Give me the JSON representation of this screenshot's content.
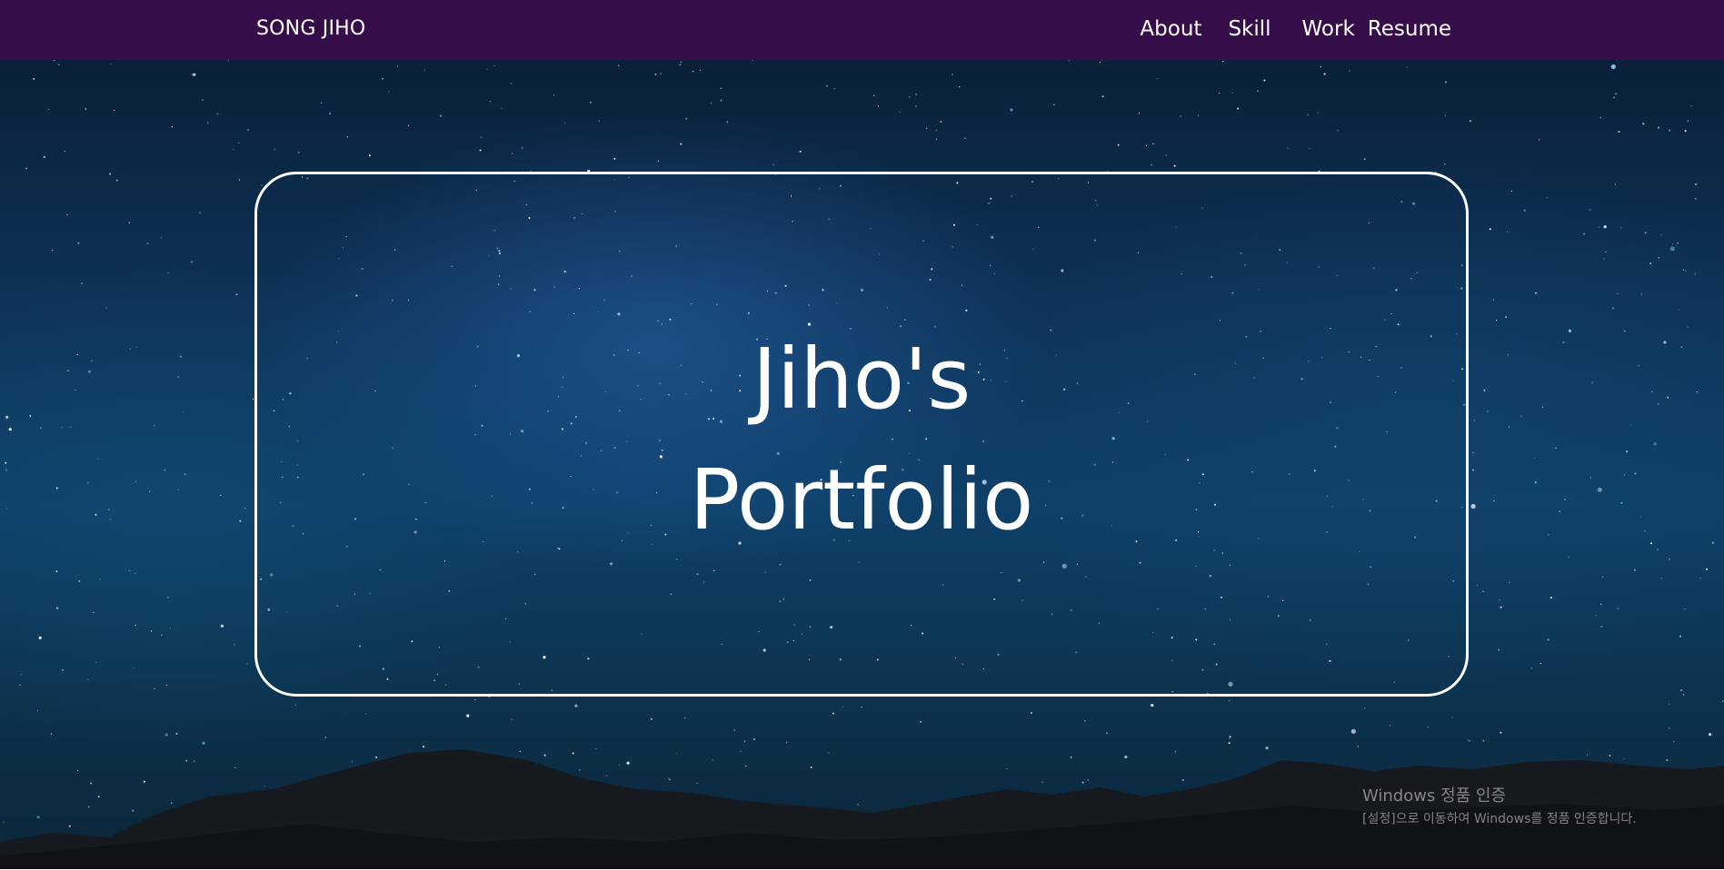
{
  "navbar": {
    "brand": "SONG JIHO",
    "links": [
      "About",
      "Skill",
      "Work",
      "Resume"
    ],
    "background": "#350d48"
  },
  "hero": {
    "title_line1": "Jiho's",
    "title_line2": "Portfolio",
    "frame_color": "#ffffff"
  },
  "windows_activation": {
    "title": "Windows 정품 인증",
    "message": "[설정]으로 이동하여 Windows를 정품 인증합니다."
  }
}
